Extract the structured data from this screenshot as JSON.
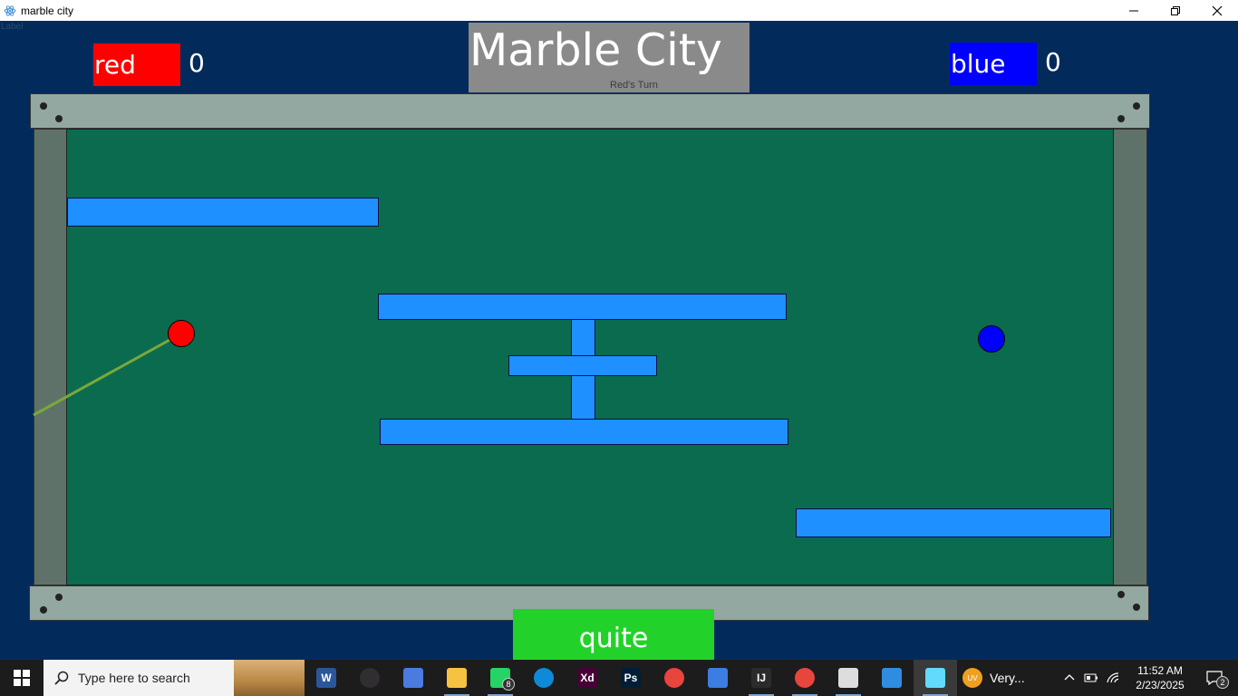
{
  "window": {
    "title": "marble city",
    "ghost_label": "Label"
  },
  "players": {
    "red": {
      "name": "red",
      "score": "0",
      "color": "#ff0000"
    },
    "blue": {
      "name": "blue",
      "score": "0",
      "color": "#0000ff"
    }
  },
  "header": {
    "title": "Marble City",
    "turn": "Red's Turn"
  },
  "board": {
    "field_color": "#0b6b4e",
    "wall_color": "#1e90ff"
  },
  "quit_button": {
    "label": "quite"
  },
  "taskbar": {
    "search_placeholder": "Type here to search",
    "pinned": [
      {
        "name": "word-icon",
        "glyph": "W",
        "color": "#2b579a"
      },
      {
        "name": "obs-icon",
        "glyph": "",
        "color": "#302e31"
      },
      {
        "name": "copilot-icon",
        "glyph": "",
        "color": "#4a7be0"
      },
      {
        "name": "file-explorer-icon",
        "glyph": "",
        "color": "#f5c341"
      },
      {
        "name": "whatsapp-icon",
        "glyph": "",
        "color": "#25d366",
        "badge": "8"
      },
      {
        "name": "edge-icon",
        "glyph": "",
        "color": "#0f8ad8"
      },
      {
        "name": "xd-icon",
        "glyph": "Xd",
        "color": "#470137"
      },
      {
        "name": "photoshop-icon",
        "glyph": "Ps",
        "color": "#001e36"
      },
      {
        "name": "chrome-icon",
        "glyph": "",
        "color": "#e8453c"
      },
      {
        "name": "store-icon",
        "glyph": "",
        "color": "#3b7de0"
      },
      {
        "name": "intellij-icon",
        "glyph": "IJ",
        "color": "#2b2b2b"
      },
      {
        "name": "chrome-profile-icon",
        "glyph": "",
        "color": "#e8453c"
      },
      {
        "name": "photos-icon",
        "glyph": "",
        "color": "#dddddd"
      },
      {
        "name": "maps-icon",
        "glyph": "",
        "color": "#2f8ce0"
      },
      {
        "name": "react-app-icon",
        "glyph": "",
        "color": "#61dafb",
        "active": true
      }
    ],
    "weather": {
      "badge": "UV",
      "text": "Very..."
    },
    "clock": {
      "time": "11:52 AM",
      "date": "2/23/2025"
    },
    "notifications": "2"
  }
}
